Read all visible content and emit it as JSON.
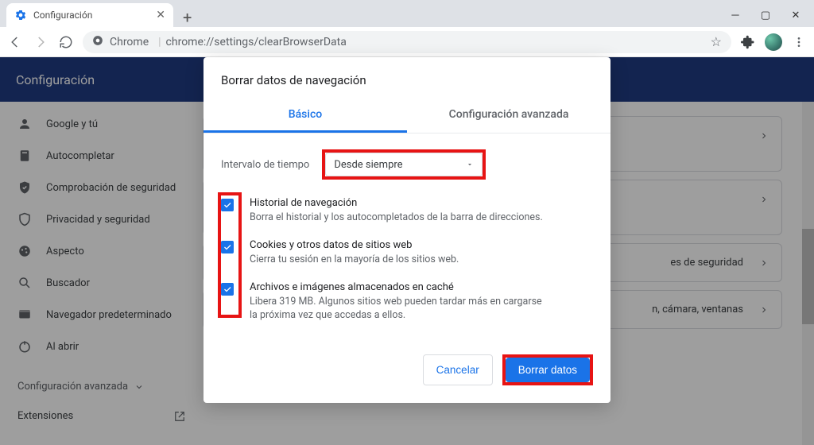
{
  "tab": {
    "title": "Configuración"
  },
  "omnibox": {
    "chip": "Chrome",
    "url": "chrome://settings/clearBrowserData"
  },
  "bluebar": {
    "title": "Configuración"
  },
  "sidebar": {
    "items": [
      {
        "label": "Google y tú"
      },
      {
        "label": "Autocompletar"
      },
      {
        "label": "Comprobación de seguridad"
      },
      {
        "label": "Privacidad y seguridad"
      },
      {
        "label": "Aspecto"
      },
      {
        "label": "Buscador"
      },
      {
        "label": "Navegador predeterminado"
      },
      {
        "label": "Al abrir"
      }
    ],
    "advanced": "Configuración avanzada",
    "extensions": "Extensiones"
  },
  "rightpeek": {
    "row1": "es de seguridad",
    "row2": "n, cámara, ventanas"
  },
  "dialog": {
    "title": "Borrar datos de navegación",
    "tab_basic": "Básico",
    "tab_advanced": "Configuración avanzada",
    "range_label": "Intervalo de tiempo",
    "range_value": "Desde siempre",
    "items": [
      {
        "head": "Historial de navegación",
        "sub": "Borra el historial y los autocompletados de la barra de direcciones."
      },
      {
        "head": "Cookies y otros datos de sitios web",
        "sub": "Cierra tu sesión en la mayoría de los sitios web."
      },
      {
        "head": "Archivos e imágenes almacenados en caché",
        "sub": "Libera 319 MB. Algunos sitios web pueden tardar más en cargarse la próxima vez que accedas a ellos."
      }
    ],
    "cancel": "Cancelar",
    "confirm": "Borrar datos"
  }
}
